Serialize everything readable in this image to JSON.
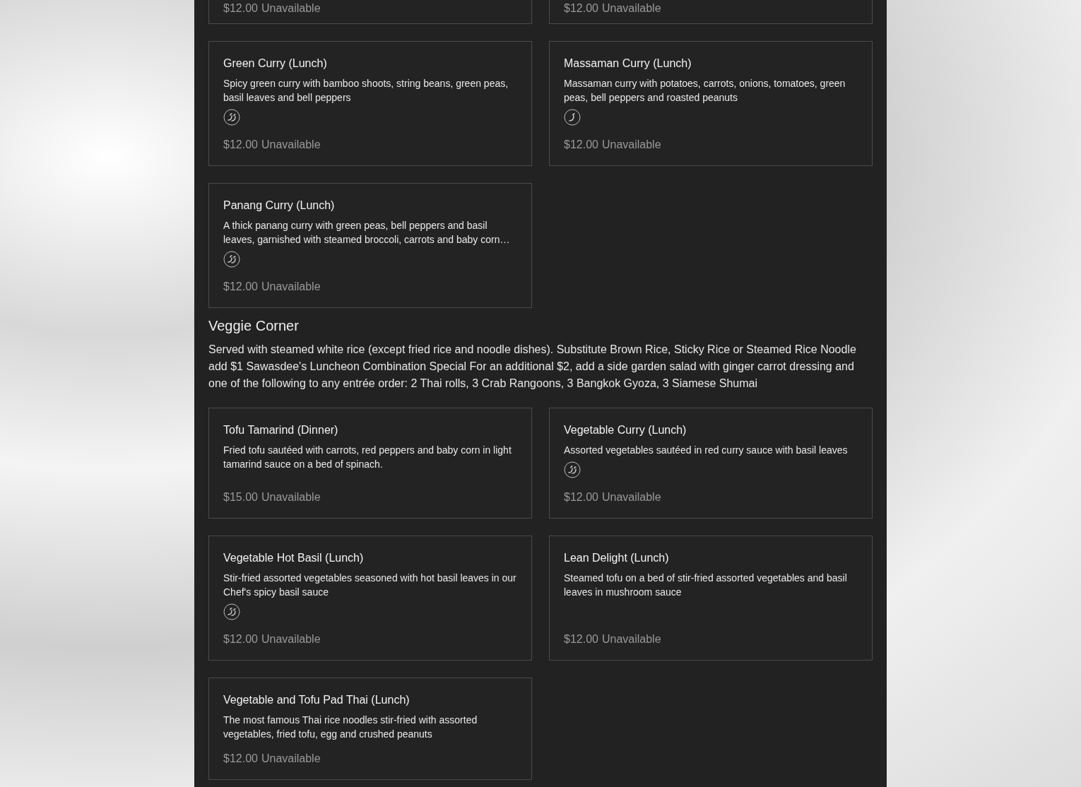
{
  "sections": [
    {
      "partial_top": true,
      "items": [
        {
          "price": "$12.00",
          "status": "Unavailable"
        },
        {
          "price": "$12.00",
          "status": "Unavailable"
        },
        {
          "name": "Green Curry (Lunch)",
          "description": "Spicy green curry with bamboo shoots, string beans, green peas, basil leaves and bell peppers",
          "kind": "hot",
          "price": "$12.00",
          "status": "Unavailable"
        },
        {
          "name": "Massaman Curry (Lunch)",
          "description": "Massaman curry with potatoes, carrots, onions, tomatoes, green peas, bell peppers and roasted peanuts",
          "kind": "mild",
          "price": "$12.00",
          "status": "Unavailable"
        },
        {
          "name": "Panang Curry (Lunch)",
          "description": "A thick panang curry with green peas, bell peppers and basil leaves, garnished with steamed broccoli, carrots and baby corn…",
          "kind": "hot",
          "price": "$12.00",
          "status": "Unavailable"
        }
      ]
    },
    {
      "title": "Veggie Corner",
      "description": "Served with steamed white rice (except fried rice and noodle dishes). Substitute Brown Rice, Sticky Rice or Steamed Rice Noodle add $1 Sawasdee's Luncheon Combination Special For an additional $2, add a side garden salad with ginger carrot dressing and one of the following to any entrée order: 2 Thai rolls, 3 Crab Rangoons, 3 Bangkok Gyoza, 3 Siamese Shumai",
      "items": [
        {
          "name": "Tofu Tamarind (Dinner)",
          "description": "Fried tofu sautéed with carrots, red peppers and baby corn in light tamarind sauce on a bed of spinach.",
          "price": "$15.00",
          "status": "Unavailable"
        },
        {
          "name": "Vegetable Curry (Lunch)",
          "description": "Assorted vegetables sautéed in red curry sauce with basil leaves",
          "kind": "hot",
          "price": "$12.00",
          "status": "Unavailable"
        },
        {
          "name": "Vegetable Hot Basil (Lunch)",
          "description": "Stir-fried assorted vegetables seasoned with hot basil leaves in our Chef's spicy basil sauce",
          "kind": "hot",
          "price": "$12.00",
          "status": "Unavailable"
        },
        {
          "name": "Lean Delight (Lunch)",
          "description": "Steamed tofu on a bed of stir-fried assorted vegetables and basil leaves in mushroom sauce",
          "price": "$12.00",
          "status": "Unavailable"
        },
        {
          "name": "Vegetable and Tofu Pad Thai (Lunch)",
          "description": "The most famous Thai rice noodles stir-fried with assorted vegetables, fried tofu, egg and crushed peanuts",
          "price": "$12.00",
          "status": "Unavailable"
        }
      ]
    }
  ]
}
